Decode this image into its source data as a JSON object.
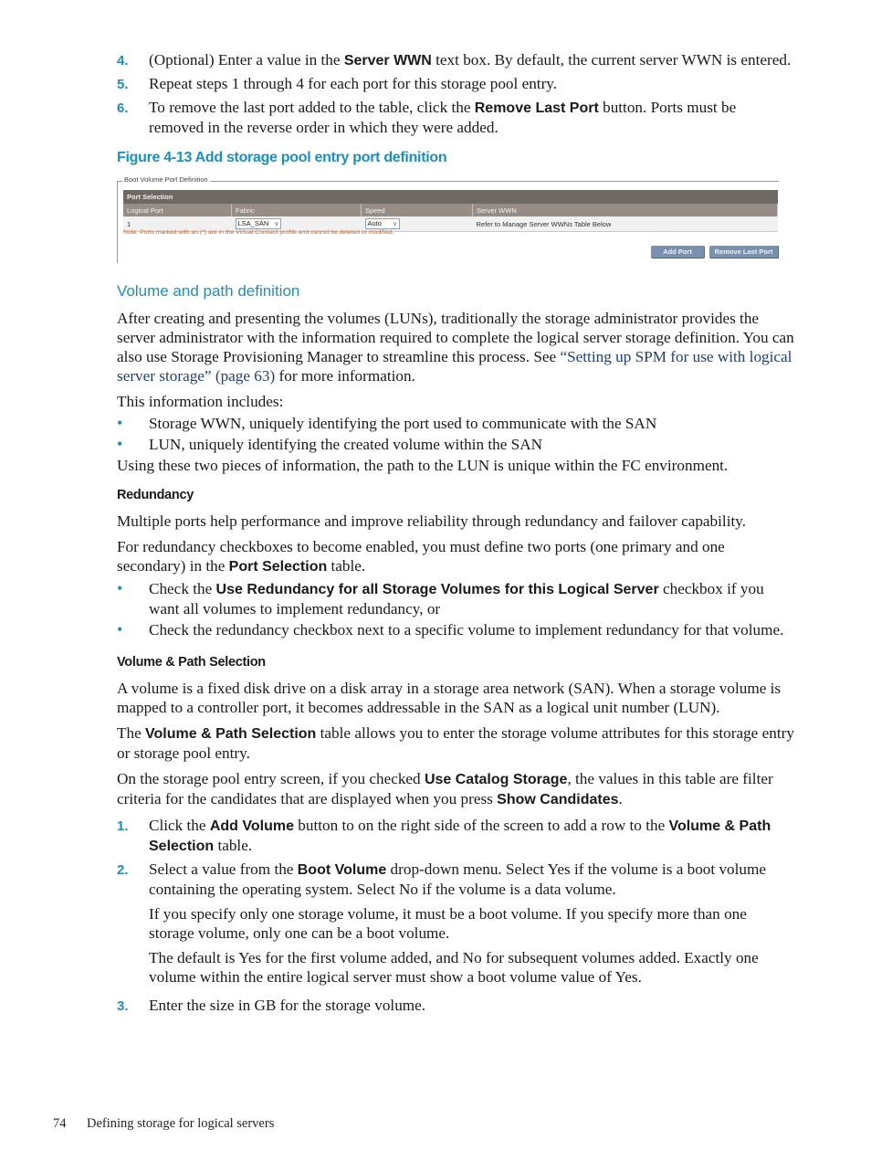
{
  "steps_top": [
    {
      "num": "4.",
      "pre": "(Optional) Enter a value in the ",
      "bold": "Server WWN",
      "post": " text box. By default, the current server WWN is entered."
    },
    {
      "num": "5.",
      "text": "Repeat steps 1 through 4 for each port for this storage pool entry."
    },
    {
      "num": "6.",
      "pre": "To remove the last port added to the table, click the ",
      "bold": "Remove Last Port",
      "post": " button. Ports must be removed in the reverse order in which they were added."
    }
  ],
  "figure": {
    "caption": "Figure 4-13 Add storage pool entry port definition",
    "legend": "Boot Volume Port Definition",
    "table_title": "Port Selection",
    "columns": [
      "Logical Port",
      "Fabric",
      "Speed",
      "Server WWN"
    ],
    "rows": [
      {
        "logical_port": "1",
        "fabric": "LSA_SAN",
        "speed": "Auto",
        "server_wwn": "Refer to Manage Server WWNs Table Below"
      }
    ],
    "note": "Note: Ports marked with an (*) are in the Virtual Connect profile and cannot be deleted or modified.",
    "buttons": {
      "add_port": "Add Port",
      "remove_last_port": "Remove Last Port"
    },
    "colors": {
      "title_bar": "#6e6862",
      "header_bar": "#958d86",
      "note": "#d2622a",
      "button": "#7991ae"
    }
  },
  "section_volume": {
    "heading": "Volume and path definition",
    "para1_pre": "After creating and presenting the volumes (LUNs), traditionally the storage administrator provides the server administrator with the information required to complete the logical server storage definition. You can also use Storage Provisioning Manager to streamline this process. See ",
    "para1_link": "“Setting up SPM for use with logical server storage” (page 63)",
    "para1_post": " for more information.",
    "para2": "This information includes:",
    "bullets": [
      "Storage WWN, uniquely identifying the port used to communicate with the SAN",
      "LUN, uniquely identifying the created volume within the SAN"
    ],
    "para3": "Using these two pieces of information, the path to the LUN is unique within the FC environment."
  },
  "section_redundancy": {
    "heading": "Redundancy",
    "para1": "Multiple ports help performance and improve reliability through redundancy and failover capability.",
    "para2_pre": "For redundancy checkboxes to become enabled, you must define two ports (one primary and one secondary) in the ",
    "para2_bold": "Port Selection",
    "para2_post": "  table.",
    "bullets": [
      {
        "pre": "Check the ",
        "bold": "Use Redundancy for all Storage Volumes for this Logical Server",
        "post": " checkbox if you want all volumes to implement redundancy, or"
      },
      {
        "pre": "Check the redundancy checkbox next to a specific volume to implement redundancy for that volume.",
        "bold": "",
        "post": ""
      }
    ]
  },
  "section_vps": {
    "heading": "Volume & Path Selection",
    "para1": "A volume is a fixed disk drive on a disk array in a storage area network (SAN). When a storage volume is mapped to a controller port, it becomes addressable in the SAN as a logical unit number (LUN).",
    "para2_pre": "The ",
    "para2_bold": "Volume & Path Selection",
    "para2_post": "  table allows you to enter the storage volume attributes for this storage entry or storage pool entry.",
    "para3_pre": "On the storage pool entry screen, if you checked ",
    "para3_bold1": "Use Catalog Storage",
    "para3_mid": ", the values in this table are filter criteria for the candidates that are displayed when you press ",
    "para3_bold2": "Show Candidates",
    "para3_post": ".",
    "steps": [
      {
        "num": "1.",
        "pre": "Click the ",
        "bold": "Add Volume",
        "mid": " button to on the right side of the screen to add a row to the ",
        "bold2": "Volume & Path Selection",
        "post": " table."
      },
      {
        "num": "2.",
        "pre": "Select a value from the ",
        "bold": "Boot Volume",
        "post": " drop-down menu. Select Yes if the volume is a boot volume containing the operating system. Select No if the volume is a data volume."
      },
      {
        "num": "3.",
        "text": "Enter the size in GB for the storage volume."
      }
    ],
    "step2_extra": [
      "If you specify only one storage volume, it must be a boot volume. If you specify more than one storage volume, only one can be a boot volume.",
      "The default is Yes for the first volume added, and No for subsequent volumes added. Exactly one volume within the entire logical server must show a boot volume value of Yes."
    ]
  },
  "footer": {
    "page_number": "74",
    "chapter": "Defining storage for logical servers"
  }
}
